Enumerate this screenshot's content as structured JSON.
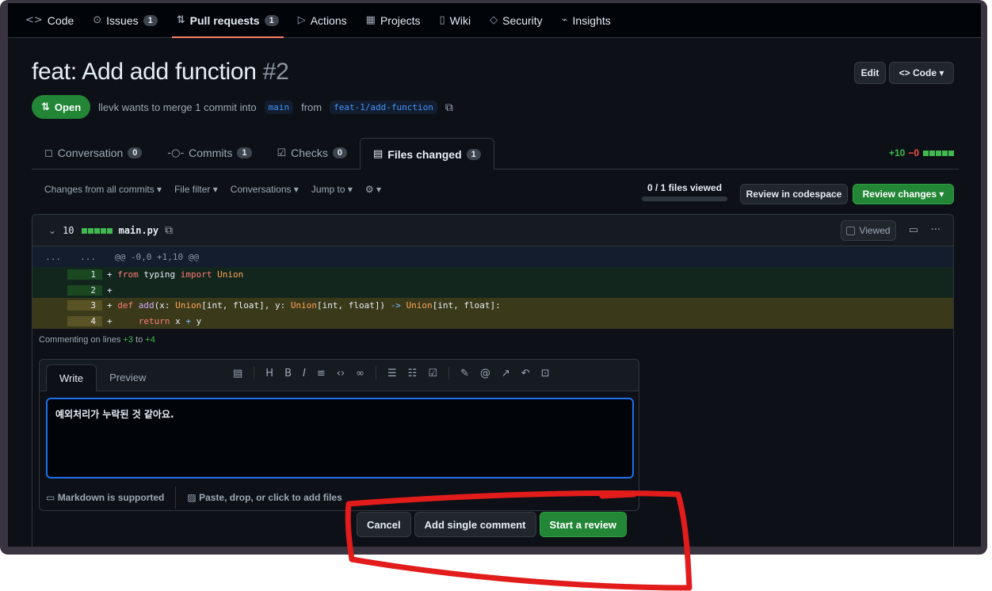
{
  "repo_nav": {
    "items": [
      {
        "icon": "<>",
        "label": "Code",
        "count": ""
      },
      {
        "icon": "⊙",
        "label": "Issues",
        "count": "1"
      },
      {
        "icon": "⇅",
        "label": "Pull requests",
        "count": "1"
      },
      {
        "icon": "▷",
        "label": "Actions",
        "count": ""
      },
      {
        "icon": "▦",
        "label": "Projects",
        "count": ""
      },
      {
        "icon": "▯",
        "label": "Wiki",
        "count": ""
      },
      {
        "icon": "◇",
        "label": "Security",
        "count": ""
      },
      {
        "icon": "⌁",
        "label": "Insights",
        "count": ""
      }
    ]
  },
  "pr": {
    "title": "feat: Add add function",
    "number": "#2",
    "edit_label": "Edit",
    "code_label": "<> Code ▾",
    "state": "Open",
    "author": "llevk",
    "merge_text_1": "wants to merge 1 commit into",
    "base_branch": "main",
    "merge_text_2": "from",
    "head_branch": "feat-1/add-function"
  },
  "tabs": [
    {
      "icon": "◻",
      "label": "Conversation",
      "count": "0"
    },
    {
      "icon": "-○-",
      "label": "Commits",
      "count": "1"
    },
    {
      "icon": "☑",
      "label": "Checks",
      "count": "0"
    },
    {
      "icon": "▤",
      "label": "Files changed",
      "count": "1"
    }
  ],
  "diffstat": {
    "additions": "+10",
    "deletions": "−0"
  },
  "toolbar": {
    "filters": [
      "Changes from all commits ▾",
      "File filter ▾",
      "Conversations ▾",
      "Jump to ▾",
      "⚙ ▾"
    ],
    "files_viewed": "0 / 1 files viewed",
    "codespace_label": "Review in codespace",
    "review_label": "Review changes ▾"
  },
  "file": {
    "changes": "10",
    "name": "main.py",
    "viewed_label": "Viewed",
    "hunk": "@@ -0,0 +1,10 @@",
    "hunk_dots": "..."
  },
  "commenting": {
    "prefix": "Commenting on lines",
    "from": "+3",
    "to_word": "to",
    "to": "+4"
  },
  "comment": {
    "write_tab": "Write",
    "preview_tab": "Preview",
    "text": "예외처리가 누락된 것 같아요.",
    "markdown_note": "Markdown is supported",
    "attach_note": "Paste, drop, or click to add files",
    "cancel_label": "Cancel",
    "single_label": "Add single comment",
    "start_label": "Start a review"
  },
  "colors": {
    "accent": "#238636",
    "link": "#4493f8",
    "annotation": "#e21b1b"
  }
}
